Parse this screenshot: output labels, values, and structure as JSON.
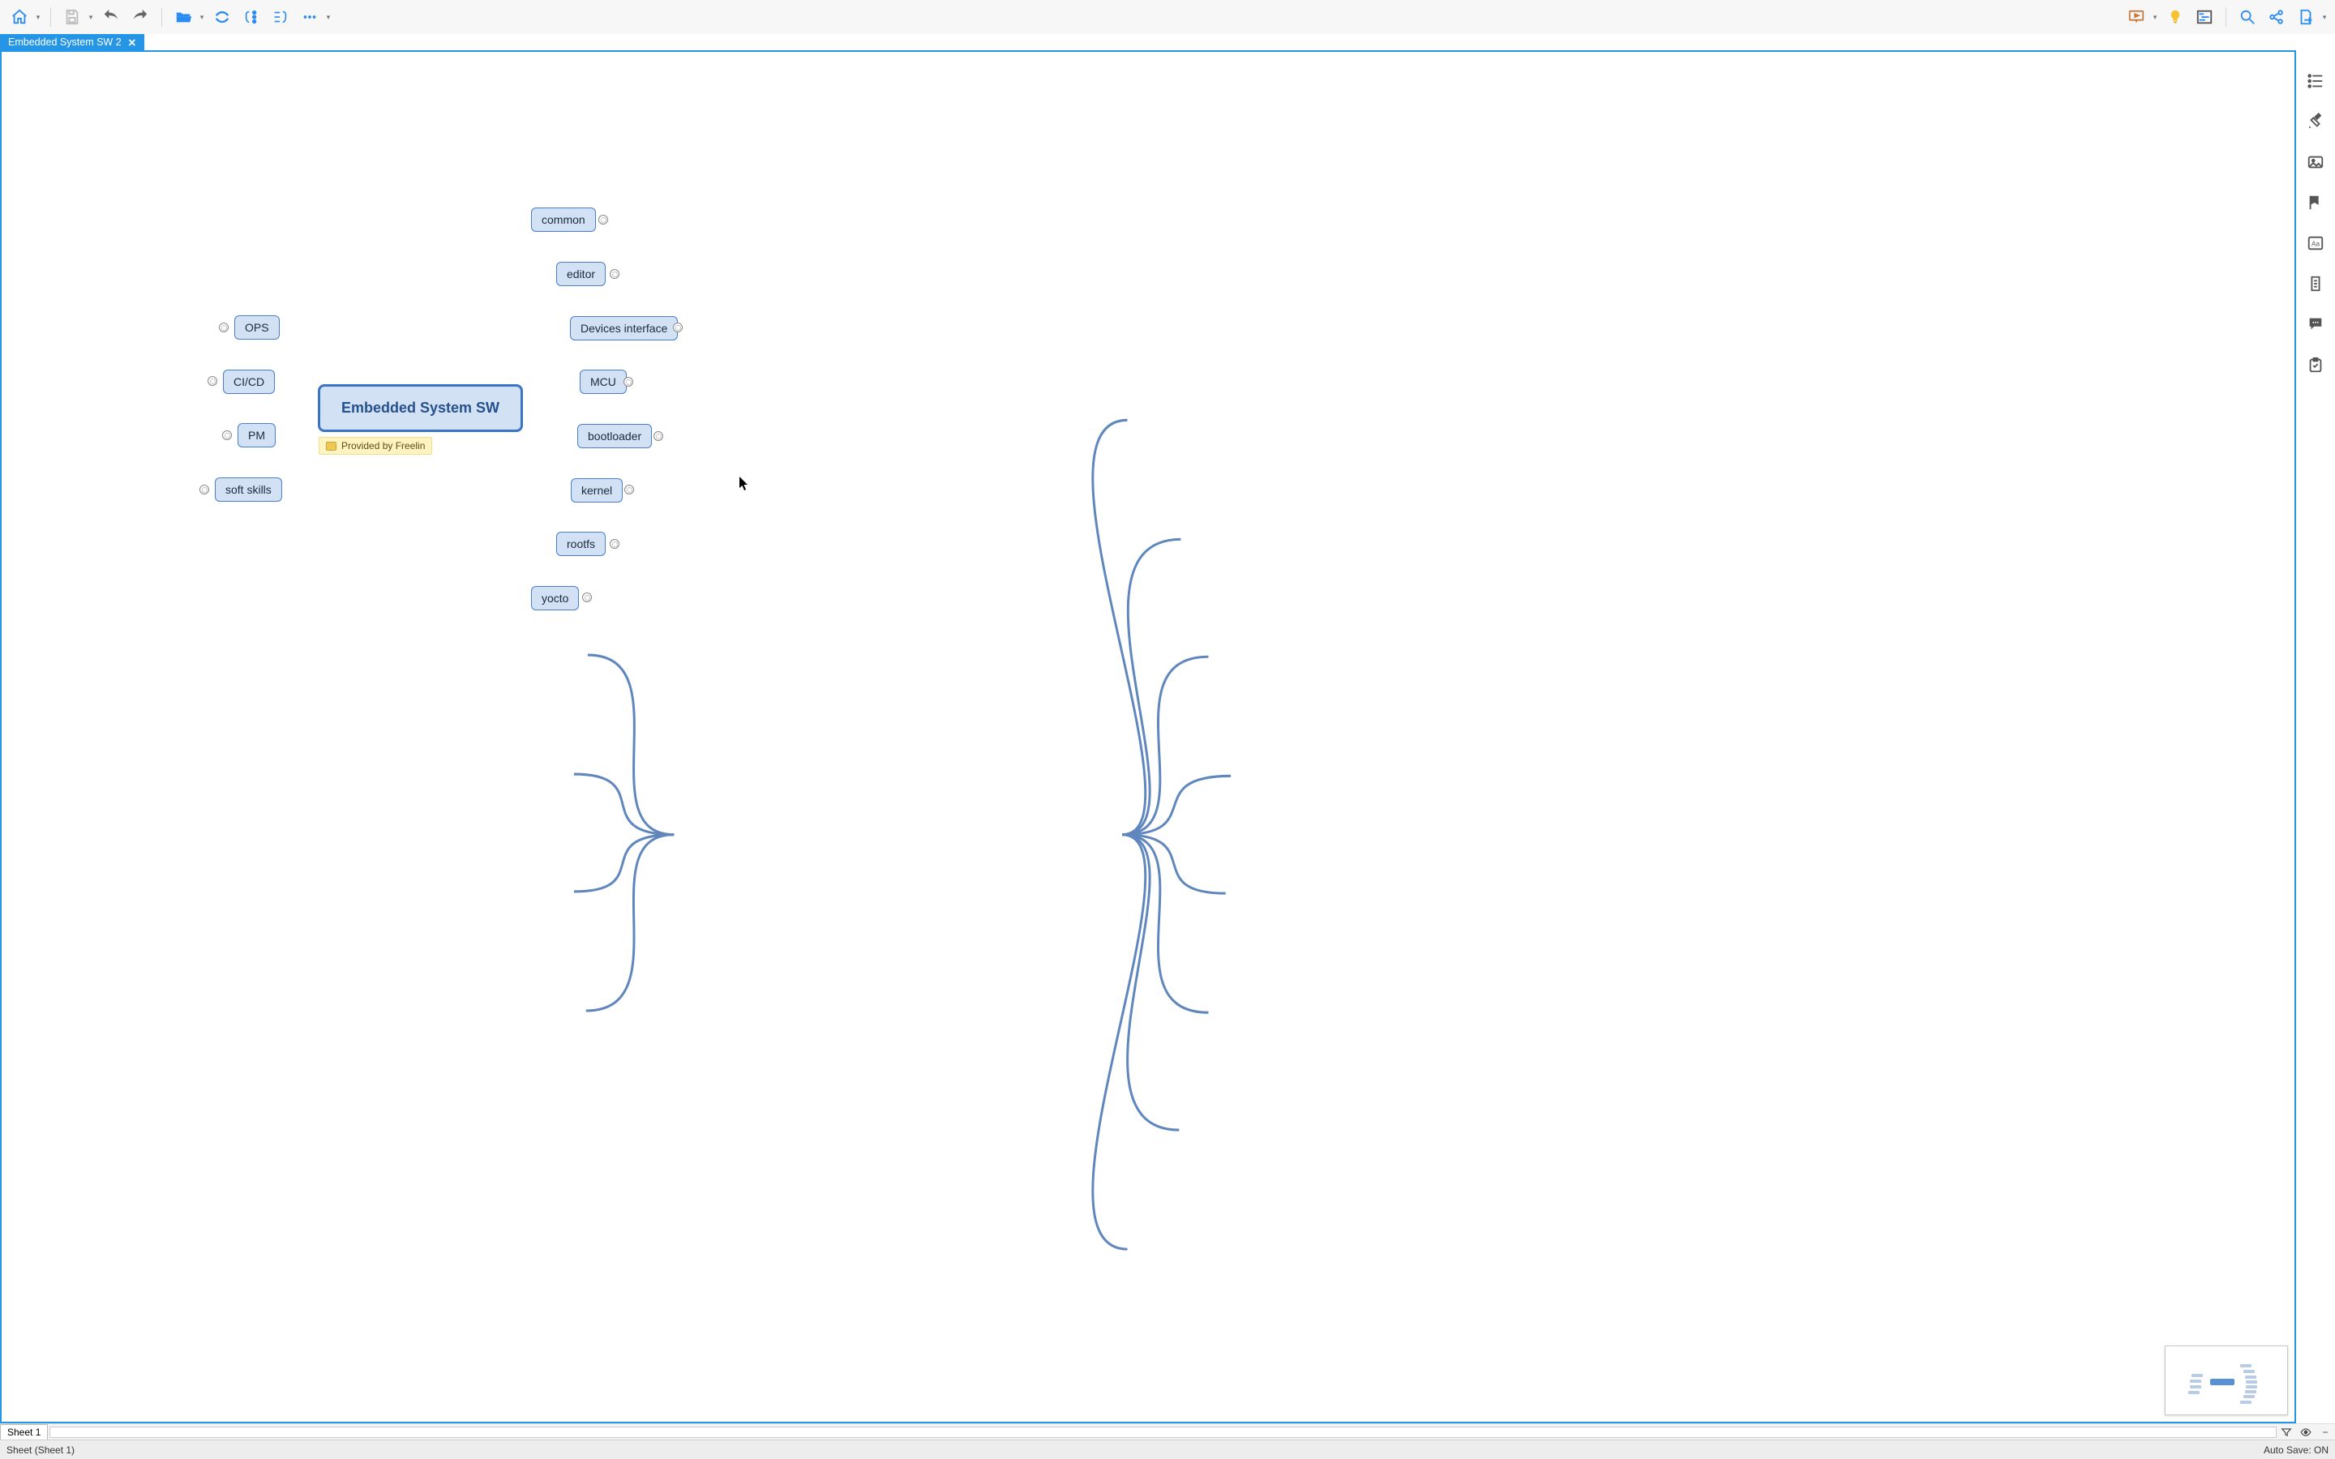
{
  "tab": {
    "title": "Embedded System SW 2"
  },
  "mindmap": {
    "center": "Embedded System SW",
    "note": "Provided by Freelin",
    "right_children": [
      "common",
      "editor",
      "Devices interface",
      "MCU",
      "bootloader",
      "kernel",
      "rootfs",
      "yocto"
    ],
    "left_children": [
      "OPS",
      "CI/CD",
      "PM",
      "soft skills"
    ]
  },
  "sheet": {
    "tab": "Sheet 1",
    "status": "Sheet (Sheet 1)"
  },
  "status": {
    "autosave_label": "Auto Save: ON"
  },
  "colors": {
    "accent": "#2596e6",
    "node_fill": "#d3e1f5",
    "node_border": "#4a7ec9"
  }
}
